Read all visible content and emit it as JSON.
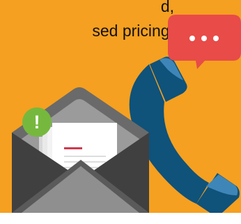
{
  "text": {
    "line1": "d,",
    "line2": "sed pricing."
  },
  "icons": {
    "bubble": "speech-bubble-icon",
    "phone": "phone-handset-icon",
    "envelope": "envelope-icon",
    "alert": "alert-exclamation-icon"
  },
  "colors": {
    "background": "#f5a020",
    "bubble": "#e84b48",
    "phone_dark": "#0f527a",
    "phone_light": "#3f86b8",
    "envelope_dark": "#404040",
    "envelope_mid": "#6a6a6a",
    "envelope_inner": "#9b9b9b",
    "alert_green": "#76b83e",
    "accent_red": "#d0394b"
  },
  "alert_glyph": "!"
}
